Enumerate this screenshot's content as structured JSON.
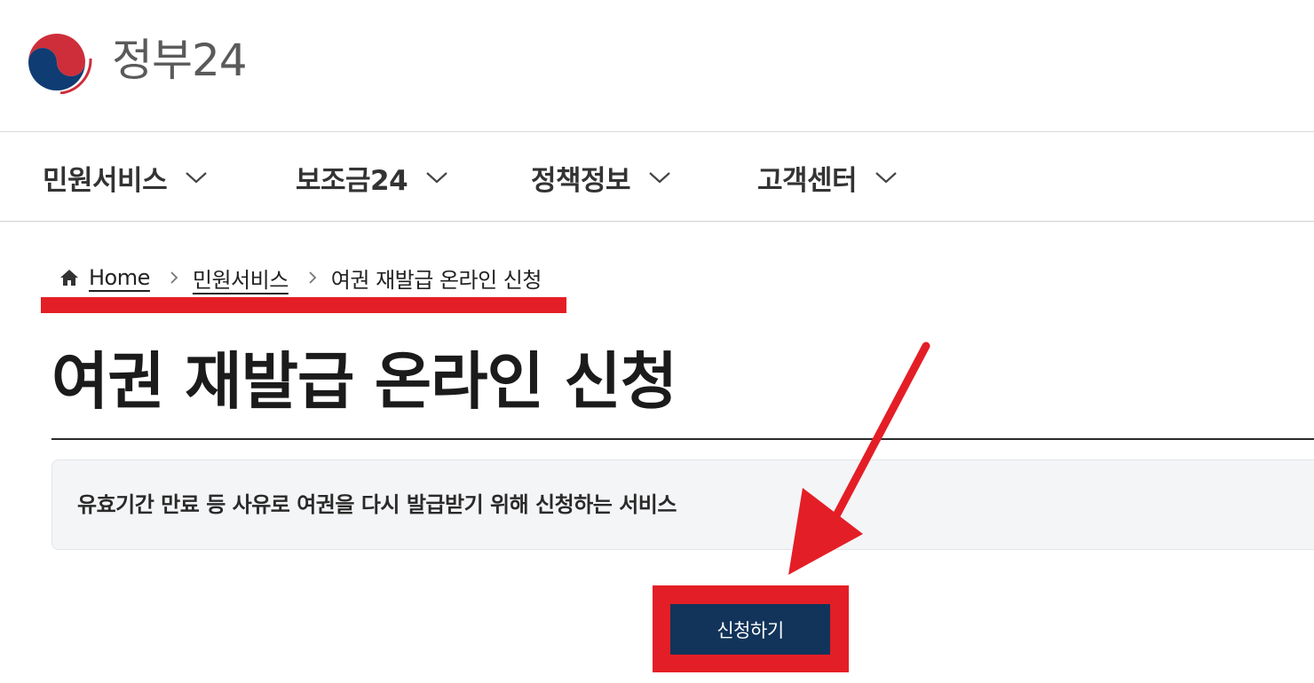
{
  "logo": {
    "text": "정부24"
  },
  "nav": {
    "items": [
      {
        "label": "민원서비스"
      },
      {
        "label": "보조금24"
      },
      {
        "label": "정책정보"
      },
      {
        "label": "고객센터"
      }
    ]
  },
  "breadcrumb": {
    "home": "Home",
    "section": "민원서비스",
    "current": "여권 재발급 온라인 신청"
  },
  "page": {
    "title": "여권 재발급 온라인 신청",
    "description": "유효기간 만료 등 사유로 여권을 다시 발급받기 위해 신청하는 서비스"
  },
  "actions": {
    "apply_label": "신청하기"
  },
  "colors": {
    "annotation_red": "#e41e26",
    "button_navy": "#12345a",
    "emblem_red": "#cd2e3a",
    "emblem_blue": "#0f3c73"
  },
  "icons": {
    "logo": "taegeuk-emblem-icon",
    "nav_chevron": "chevron-down-icon",
    "breadcrumb_home": "home-icon",
    "breadcrumb_separator": "chevron-right-icon",
    "annotation_arrow": "arrow-annotation-icon"
  }
}
